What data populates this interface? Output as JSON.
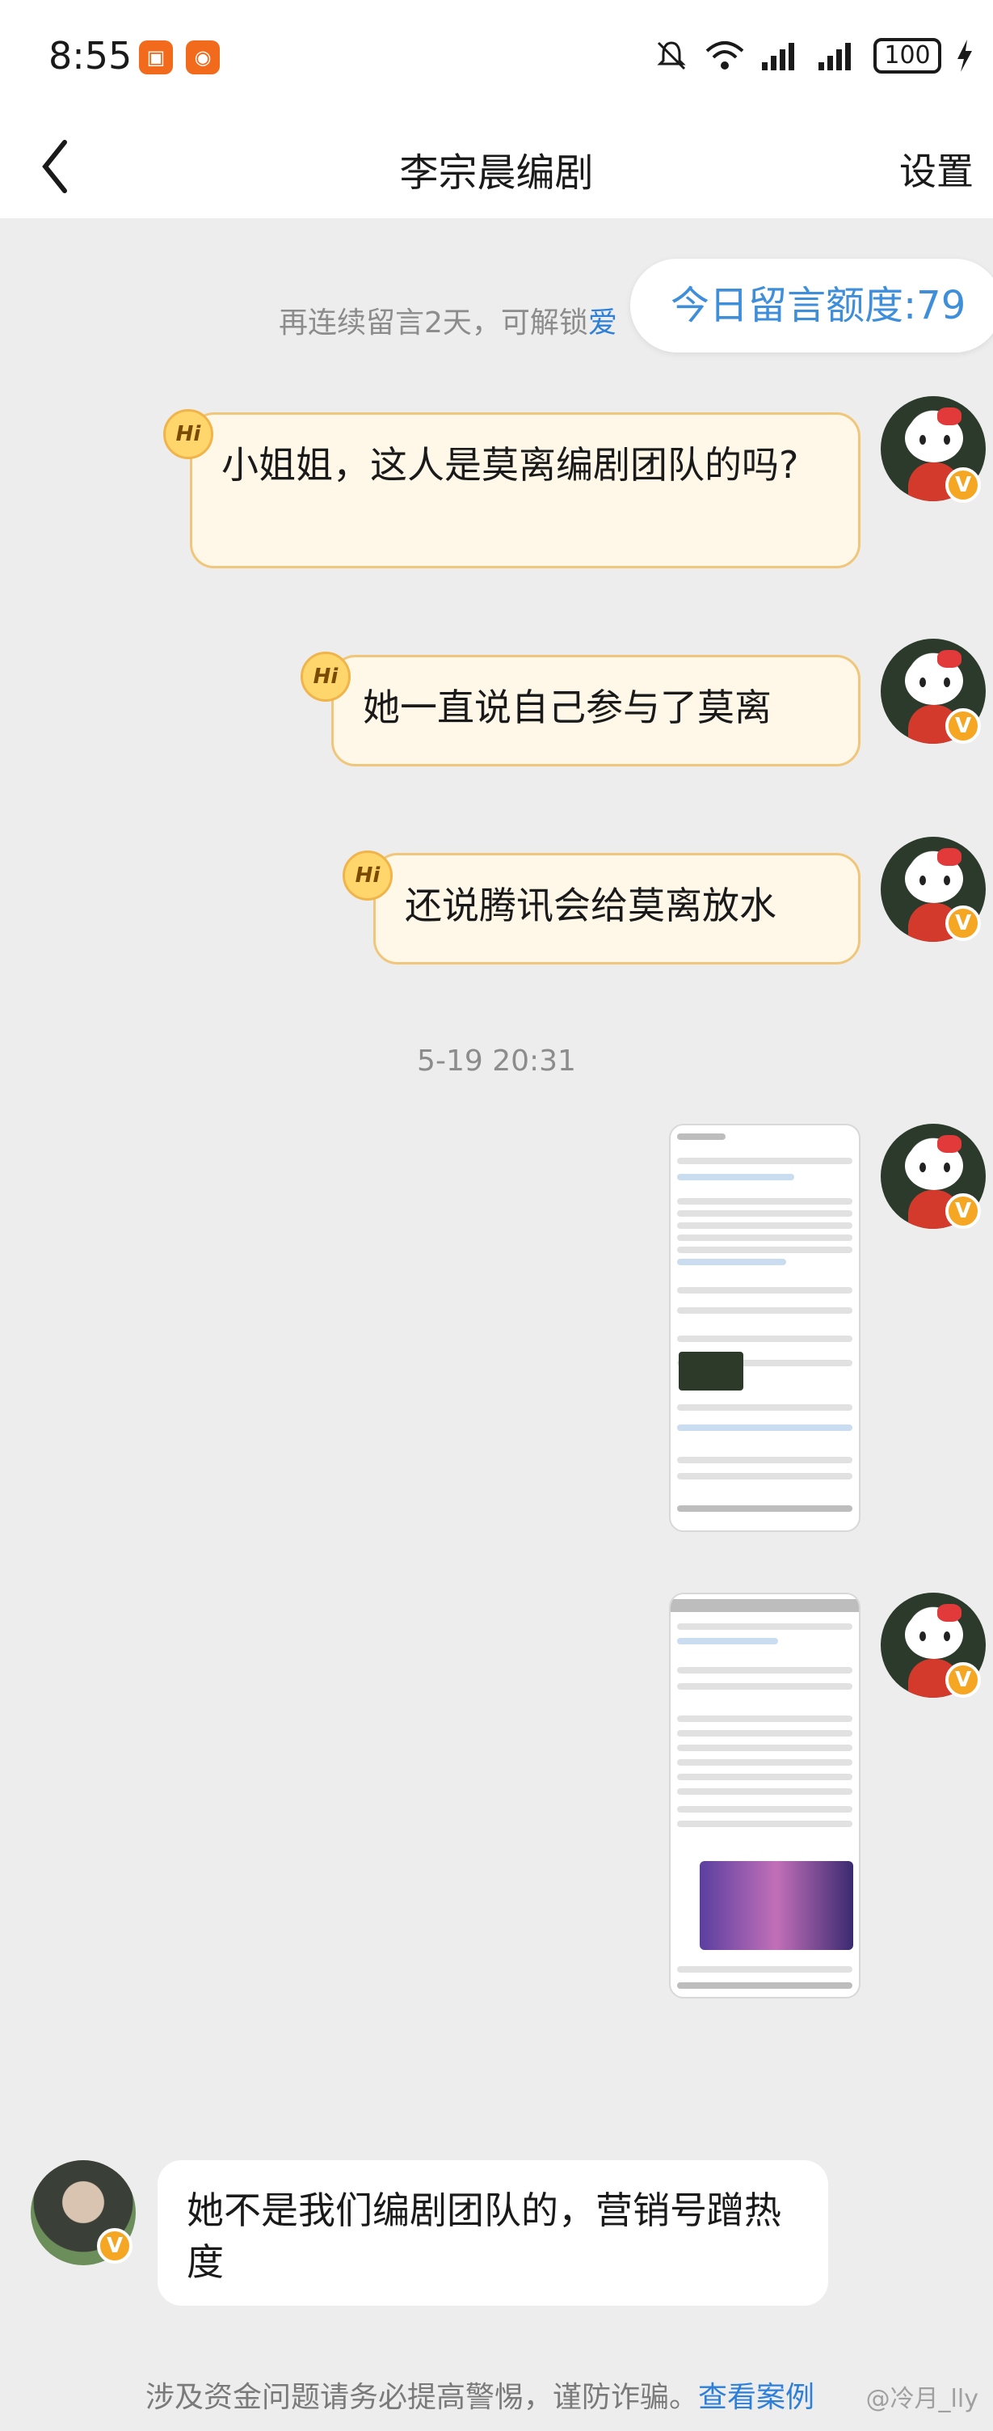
{
  "status": {
    "time": "8:55",
    "battery": "100"
  },
  "nav": {
    "title": "李宗晨编剧",
    "settings": "设置"
  },
  "hint": {
    "text": "再连续留言2天，可解锁",
    "link": "爱"
  },
  "quota": {
    "label": "今日留言额度:79"
  },
  "messages": [
    {
      "hi": "Hi",
      "text": "小姐姐，这人是莫离编剧团队的吗?"
    },
    {
      "hi": "Hi",
      "text": "她一直说自己参与了莫离"
    },
    {
      "hi": "Hi",
      "text": "还说腾讯会给莫离放水"
    }
  ],
  "timestamp": "5-19 20:31",
  "reply": {
    "text": "她不是我们编剧团队的，营销号蹭热度"
  },
  "footer": {
    "warning": "涉及资金问题请务必提高警惕，谨防诈骗。",
    "link": "查看案例"
  },
  "watermark": "@冷月_lly"
}
